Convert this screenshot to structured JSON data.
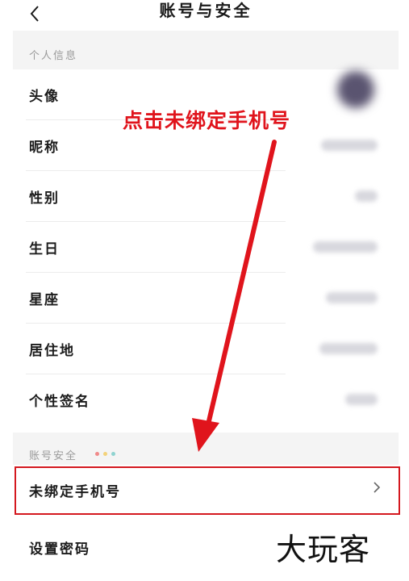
{
  "header": {
    "title": "账号与安全"
  },
  "sections": {
    "personal_info": "个人信息",
    "account_security": "账号安全"
  },
  "rows": {
    "avatar": "头像",
    "nickname": "昵称",
    "gender": "性别",
    "birthday": "生日",
    "zodiac": "星座",
    "location": "居住地",
    "signature": "个性签名",
    "unbound_phone": "未绑定手机号",
    "set_password": "设置密码"
  },
  "annotation": {
    "text": "点击未绑定手机号"
  },
  "watermark": {
    "text": "大玩客"
  },
  "colors": {
    "annotation_red": "#e0141c",
    "highlight_border": "#d4181f",
    "dot_red": "#f08a8a",
    "dot_yellow": "#f3d27a",
    "dot_teal": "#8fd3d0"
  },
  "icons": {
    "back": "chevron-left-icon",
    "row_arrow": "chevron-right-icon"
  }
}
